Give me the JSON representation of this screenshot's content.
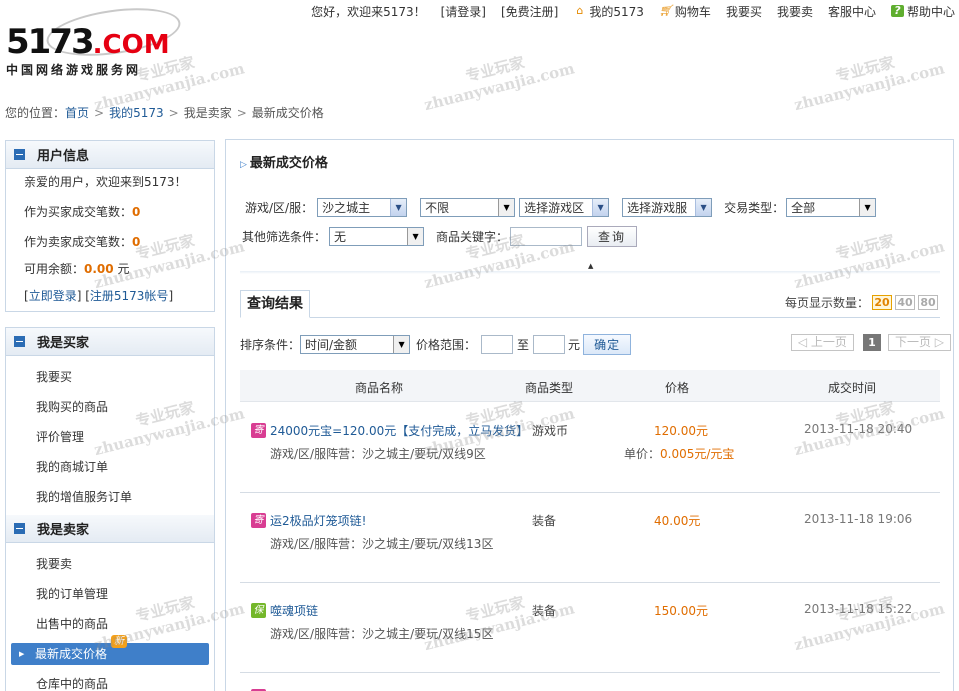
{
  "logo": {
    "main": "5173",
    "dot_com": ".COM",
    "subtitle": "中国网络游戏服务网"
  },
  "topnav": {
    "greeting": "您好，欢迎来5173！",
    "login": "[请登录]",
    "register": "[免费注册]",
    "my5173": "我的5173",
    "cart": "购物车",
    "buy": "我要买",
    "sell": "我要卖",
    "service": "客服中心",
    "help": "帮助中心"
  },
  "breadcrumb": {
    "prefix": "您的位置：",
    "items": [
      "首页",
      "我的5173",
      "我是卖家",
      "最新成交价格"
    ],
    "sep": ">"
  },
  "user_box": {
    "title": "用户信息",
    "welcome": "亲爱的用户，欢迎来到5173！",
    "buyer_label": "作为买家成交笔数：",
    "buyer_count": "0",
    "seller_label": "作为卖家成交笔数：",
    "seller_count": "0",
    "balance_label": "可用余额：",
    "balance": "0.00",
    "balance_unit": "元",
    "login_link": "立即登录",
    "register_link": "注册5173帐号"
  },
  "buyer_box": {
    "title": "我是买家",
    "items": [
      "我要买",
      "我购买的商品",
      "评价管理",
      "我的商城订单",
      "我的增值服务订单"
    ]
  },
  "seller_box": {
    "title": "我是卖家",
    "items": [
      "我要卖",
      "我的订单管理",
      "出售中的商品",
      "最新成交价格",
      "仓库中的商品"
    ],
    "new_badge": "新"
  },
  "main": {
    "title": "最新成交价格",
    "filter": {
      "game_label": "游戏/区/服：",
      "game_value": "沙之城主",
      "limit_value": "不限",
      "zone_value": "选择游戏区",
      "server_value": "选择游戏服",
      "trade_type_label": "交易类型：",
      "trade_type_value": "全部",
      "other_label": "其他筛选条件：",
      "other_value": "无",
      "keyword_label": "商品关键字：",
      "keyword_value": "",
      "search_button": "查询"
    },
    "results_tab": "查询结果",
    "per_page_label": "每页显示数量：",
    "per_page_options": [
      "20",
      "40",
      "80"
    ],
    "sort_label": "排序条件：",
    "sort_value": "时间/金额",
    "price_range_label": "价格范围：",
    "price_to": "至",
    "price_unit": "元",
    "confirm_button": "确定",
    "pager": {
      "prev": "上一页",
      "current": "1",
      "next": "下一页"
    },
    "columns": [
      "商品名称",
      "商品类型",
      "价格",
      "成交时间"
    ],
    "rows": [
      {
        "tag": "寄",
        "name": "24000元宝=120.00元【支付完成，立马发货】",
        "sub": "游戏/区/服阵营：沙之城主/要玩/双线9区",
        "type": "游戏币",
        "price": "120.00元",
        "unit_label": "单价：",
        "unit_price": "0.005元/元宝",
        "time": "2013-11-18 20:40"
      },
      {
        "tag": "寄",
        "name": "运2极品灯笼项链!",
        "sub": "游戏/区/服阵营：沙之城主/要玩/双线13区",
        "type": "装备",
        "price": "40.00元",
        "unit_label": "",
        "unit_price": "",
        "time": "2013-11-18 19:06"
      },
      {
        "tag": "保",
        "name": "噬魂项链",
        "sub": "游戏/区/服阵营：沙之城主/要玩/双线15区",
        "type": "装备",
        "price": "150.00元",
        "unit_label": "",
        "unit_price": "",
        "time": "2013-11-18 15:22"
      }
    ]
  },
  "watermark": {
    "cn": "专业玩家",
    "en": "zhuanywanjia.com"
  }
}
